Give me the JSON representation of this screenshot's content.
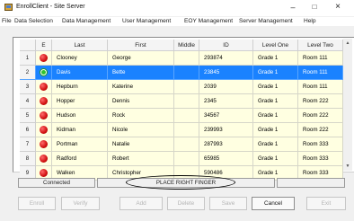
{
  "window": {
    "title": "EnrollClient - Site Server",
    "min_glyph": "–",
    "max_glyph": "□",
    "close_glyph": "×"
  },
  "menu": [
    "File",
    "Data Selection",
    "Data Management",
    "User Management",
    "EOY Management",
    "Server Management",
    "Help"
  ],
  "grid": {
    "headers": [
      "",
      "E",
      "Last",
      "First",
      "Middle",
      "ID",
      "Level One",
      "Level Two"
    ],
    "rows": [
      {
        "num": "1",
        "status": "red",
        "last": "Clooney",
        "first": "George",
        "middle": "",
        "id": "293874",
        "level_one": "Grade 1",
        "level_two": "Room 111"
      },
      {
        "num": "2",
        "status": "green",
        "last": "Davis",
        "first": "Bette",
        "middle": "",
        "id": "23845",
        "level_one": "Grade 1",
        "level_two": "Room 111"
      },
      {
        "num": "3",
        "status": "red",
        "last": "Hepburn",
        "first": "Katerine",
        "middle": "",
        "id": "2039",
        "level_one": "Grade 1",
        "level_two": "Room 111"
      },
      {
        "num": "4",
        "status": "red",
        "last": "Hopper",
        "first": "Dennis",
        "middle": "",
        "id": "2345",
        "level_one": "Grade 1",
        "level_two": "Room 222"
      },
      {
        "num": "5",
        "status": "red",
        "last": "Hudson",
        "first": "Rock",
        "middle": "",
        "id": "34567",
        "level_one": "Grade 1",
        "level_two": "Room 222"
      },
      {
        "num": "6",
        "status": "red",
        "last": "Kidman",
        "first": "Nicole",
        "middle": "",
        "id": "239993",
        "level_one": "Grade 1",
        "level_two": "Room 222"
      },
      {
        "num": "7",
        "status": "red",
        "last": "Portman",
        "first": "Natalie",
        "middle": "",
        "id": "287993",
        "level_one": "Grade 1",
        "level_two": "Room 333"
      },
      {
        "num": "8",
        "status": "red",
        "last": "Radford",
        "first": "Robert",
        "middle": "",
        "id": "65985",
        "level_one": "Grade 1",
        "level_two": "Room 333"
      },
      {
        "num": "9",
        "status": "red",
        "last": "Walken",
        "first": "Christopher",
        "middle": "",
        "id": "590486",
        "level_one": "Grade 1",
        "level_two": "Room 333"
      }
    ],
    "selected_row": 2
  },
  "status": {
    "connection": "Connected",
    "message": "PLACE RIGHT FINGER",
    "extra": ""
  },
  "buttons": {
    "enroll": "Enroll",
    "verify": "Verify",
    "add": "Add",
    "delete": "Delete",
    "save": "Save",
    "cancel": "Cancel",
    "exit": "Exit"
  },
  "icons": {
    "app": "app-icon",
    "scroll_up": "▲",
    "scroll_down": "▼"
  }
}
